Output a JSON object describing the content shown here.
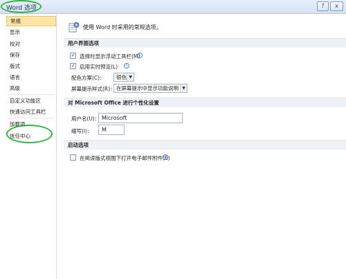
{
  "window": {
    "title": "Word 选项",
    "help_label": "?",
    "close_label": "x"
  },
  "sidebar": {
    "items": [
      {
        "label": "常规"
      },
      {
        "label": "显示"
      },
      {
        "label": "校对"
      },
      {
        "label": "保存"
      },
      {
        "label": "版式"
      },
      {
        "label": "语言"
      },
      {
        "label": "高级"
      },
      {
        "label": "自定义功能区"
      },
      {
        "label": "快速访问工具栏"
      },
      {
        "label": "加载项"
      },
      {
        "label": "信任中心"
      }
    ],
    "selected": "常规"
  },
  "main": {
    "intro": "使用 Word 时采用的常规选项。",
    "ui_section": {
      "header": "用户界面选项",
      "checkboxes": [
        {
          "label": "选择时显示浮动工具栏(M)",
          "checked": true
        },
        {
          "label": "启用实时预览(L)",
          "checked": true
        }
      ],
      "color_scheme": {
        "label": "配色方案(C):",
        "value": "银色"
      },
      "screentip_style": {
        "label": "屏幕提示样式(R):",
        "value": "在屏幕提示中显示功能说明"
      }
    },
    "personalize_section": {
      "header": "对 Microsoft Office 进行个性化设置",
      "username": {
        "label": "用户名(U):",
        "value": "Microsoft"
      },
      "initials": {
        "label": "缩写(I):",
        "value": "M"
      }
    },
    "startup_section": {
      "header": "启动选项",
      "checkbox": {
        "label": "在阅读版式视图下打开电子邮件附件(E)",
        "checked": false
      }
    }
  },
  "colors": {
    "selected_bg": "#fde6a5",
    "annotation_circle": "#2fb53c",
    "section_header_bg": "#eef1f5"
  }
}
